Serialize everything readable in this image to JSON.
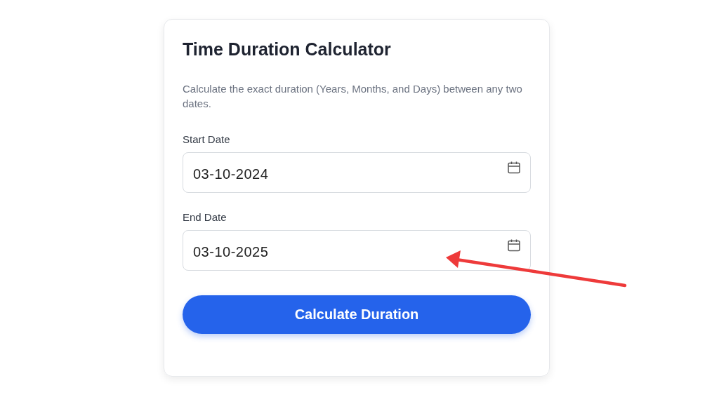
{
  "card": {
    "title": "Time Duration Calculator",
    "description": "Calculate the exact duration (Years, Months, and Days) between any two dates.",
    "fields": [
      {
        "label": "Start Date",
        "value": "03-10-2024"
      },
      {
        "label": "End Date",
        "value": "03-10-2025"
      }
    ],
    "button": "Calculate Duration"
  },
  "annotations": [
    {
      "kind": "arrow"
    }
  ]
}
